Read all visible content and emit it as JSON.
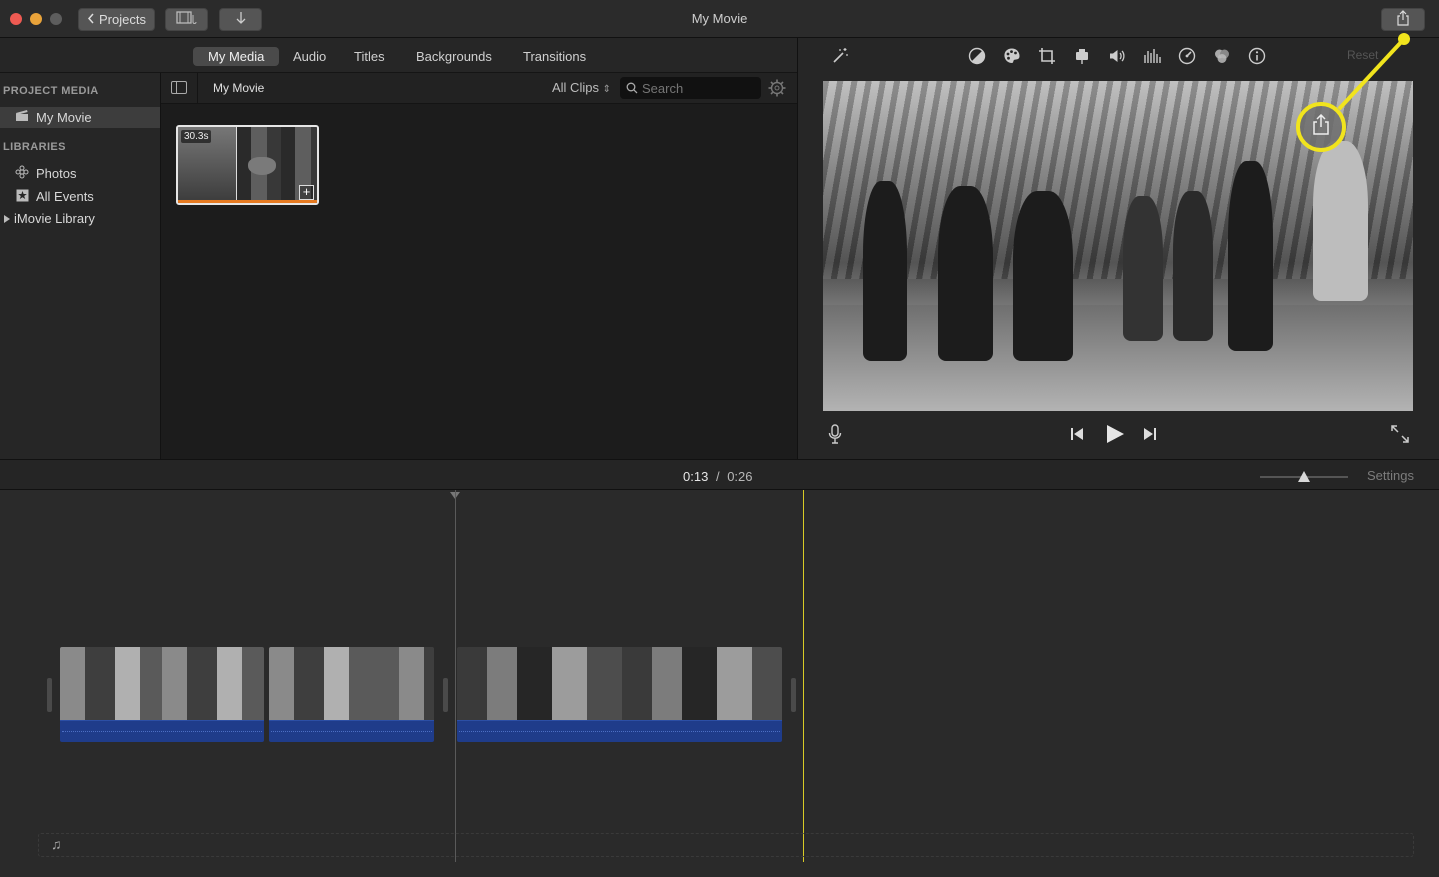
{
  "window": {
    "title": "My Movie"
  },
  "toolbar": {
    "projects_label": "Projects",
    "media_icon": "media-browser-icon",
    "import_icon": "import-arrow-icon",
    "share_icon": "share-icon"
  },
  "browser_tabs": [
    {
      "label": "My Media",
      "active": true
    },
    {
      "label": "Audio",
      "active": false
    },
    {
      "label": "Titles",
      "active": false
    },
    {
      "label": "Backgrounds",
      "active": false
    },
    {
      "label": "Transitions",
      "active": false
    }
  ],
  "sidebar": {
    "project_media_heading": "PROJECT MEDIA",
    "project_item": "My Movie",
    "libraries_heading": "LIBRARIES",
    "libraries": [
      "Photos",
      "All Events",
      "iMovie Library"
    ]
  },
  "library": {
    "title": "My Movie",
    "filter": "All Clips",
    "search_placeholder": "Search",
    "clip_duration": "30.3s"
  },
  "viewer": {
    "reset_label": "Reset",
    "tools": [
      "magic-wand-icon",
      "color-balance-icon",
      "color-correction-icon",
      "crop-icon",
      "stabilization-icon",
      "volume-icon",
      "noise-reduction-icon",
      "speed-icon",
      "clip-filter-icon",
      "info-icon"
    ]
  },
  "timeline": {
    "current_time": "0:13",
    "separator": "/",
    "total_time": "0:26",
    "settings_label": "Settings"
  },
  "colors": {
    "highlight": "#f1e41d",
    "audio_track": "#1f3c8a",
    "clip_trim_bar": "#e57a21"
  }
}
